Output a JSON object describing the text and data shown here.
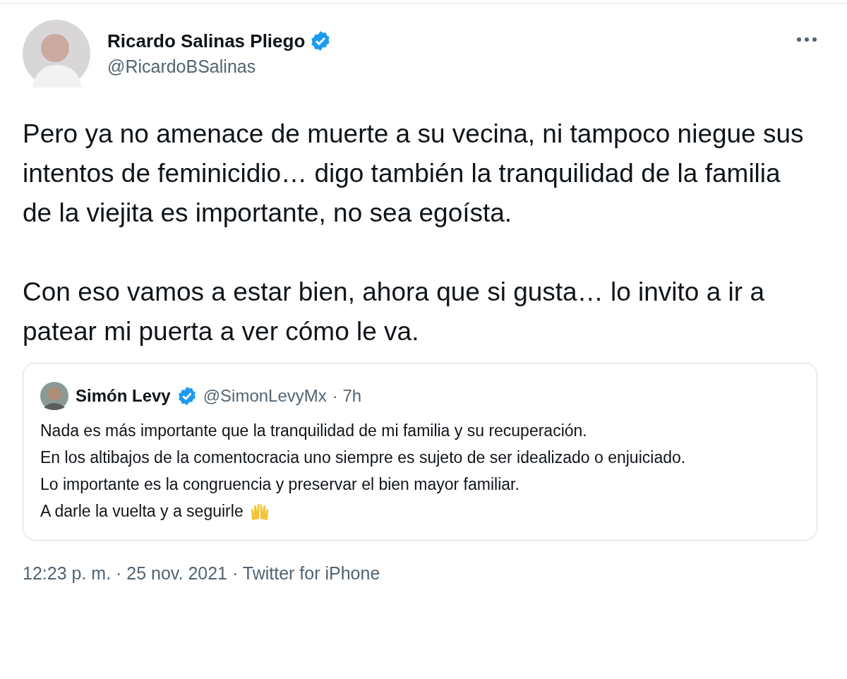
{
  "author": {
    "name": "Ricardo Salinas Pliego",
    "handle": "@RicardoBSalinas",
    "verified": true
  },
  "paragraphs": [
    "Pero ya no amenace de muerte a su vecina, ni tampoco niegue sus intentos de feminicidio… digo también la tranquilidad de la familia de la viejita es importante, no sea egoísta.",
    "Con eso vamos a estar bien, ahora que si gusta… lo invito a ir a patear mi puerta a ver cómo le va."
  ],
  "quoted": {
    "name": "Simón Levy",
    "verified": true,
    "handle": "@SimonLevyMx",
    "time": "· 7h",
    "lines": [
      "Nada es más importante que la tranquilidad de mi familia y su recuperación.",
      "En los altibajos de la comentocracia uno siempre es sujeto de ser idealizado o enjuiciado.",
      "Lo importante es la congruencia y preservar el bien mayor familiar.",
      "A darle la vuelta y a seguirle"
    ]
  },
  "meta": "12:23 p. m. · 25 nov. 2021 · Twitter for iPhone"
}
